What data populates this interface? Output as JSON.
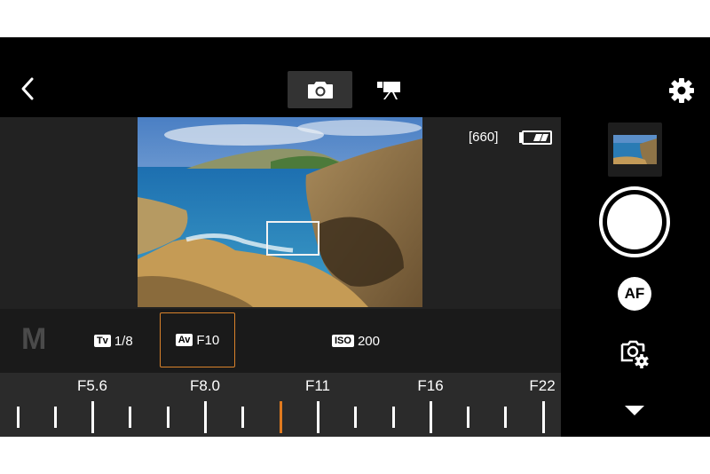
{
  "header": {
    "back_icon": "chevron-left-icon",
    "modes": [
      {
        "name": "photo",
        "icon": "camera-icon",
        "selected": true
      },
      {
        "name": "video",
        "icon": "movie-camera-icon",
        "selected": false
      }
    ],
    "settings_icon": "gear-icon"
  },
  "viewfinder": {
    "shots_remaining": "[660]",
    "battery_icon": "battery-icon"
  },
  "side": {
    "thumbnail_icon": "last-shot-thumbnail",
    "shutter_icon": "shutter-button",
    "af_label": "AF",
    "camera_settings_icon": "camera-settings-icon",
    "more_icon": "triangle-down-icon"
  },
  "exposure": {
    "mode": "M",
    "tv_tag": "Tv",
    "tv_value": "1/8",
    "av_tag": "Av",
    "av_value": "F10",
    "iso_tag": "ISO",
    "iso_value": "200",
    "accent_color": "#e07a1f"
  },
  "dial": {
    "labels": [
      "F5.6",
      "F8.0",
      "F11",
      "F16",
      "F22"
    ],
    "current_value": "F10"
  }
}
